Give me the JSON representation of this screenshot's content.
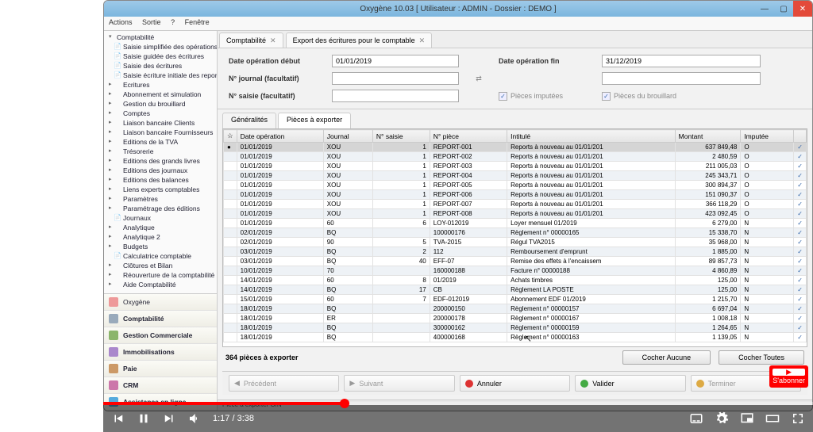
{
  "window": {
    "title": "Oxygène 10.03 [ Utilisateur : ADMIN - Dossier : DEMO ]",
    "menus": {
      "m1": "Actions",
      "m2": "Sortie",
      "m3": "?",
      "m4": "Fenêtre"
    }
  },
  "tree": {
    "root": "Comptabilité",
    "items": [
      "Saisie simplifiée des opérations",
      "Saisie guidée des écritures",
      "Saisie des écritures",
      "Saisie écriture initiale des reports",
      "Ecritures",
      "Abonnement et simulation",
      "Gestion du brouillard",
      "Comptes",
      "Liaison bancaire Clients",
      "Liaison bancaire Fournisseurs",
      "Editions de la TVA",
      "Trésorerie",
      "Editions des grands livres",
      "Editions des journaux",
      "Editions des balances",
      "Liens experts comptables",
      "Paramètres",
      "Paramétrage des éditions",
      "Journaux",
      "Analytique",
      "Analytique 2",
      "Budgets",
      "Calculatrice comptable",
      "Clôtures et Bilan",
      "Réouverture de la comptabilité",
      "Aide Comptabilité"
    ]
  },
  "modules": {
    "m0": "Oxygène",
    "m1": "Comptabilité",
    "m2": "Gestion Commerciale",
    "m3": "Immobilisations",
    "m4": "Paie",
    "m5": "CRM",
    "m6": "Assistance en ligne"
  },
  "tabs": {
    "t0": "Comptabilité",
    "t1": "Export des écritures pour le comptable"
  },
  "form": {
    "dateStartLabel": "Date opération début",
    "dateStart": "01/01/2019",
    "dateEndLabel": "Date opération fin",
    "dateEnd": "31/12/2019",
    "journalLabel": "N° journal (facultatif)",
    "saisieLabel": "N° saisie (facultatif)",
    "chk1": "Pièces imputées",
    "chk2": "Pièces du brouillard"
  },
  "subtabs": {
    "s0": "Généralités",
    "s1": "Pièces à exporter"
  },
  "grid": {
    "headers": {
      "h0": "Date opération",
      "h1": "Journal",
      "h2": "N° saisie",
      "h3": "N° pièce",
      "h4": "Intitulé",
      "h5": "Montant",
      "h6": "Imputée"
    },
    "rows": [
      {
        "d": "01/01/2019",
        "j": "XOU",
        "s": "1",
        "p": "REPORT-001",
        "i": "Reports à nouveau au 01/01/201",
        "m": "637 849,48",
        "f": "O"
      },
      {
        "d": "01/01/2019",
        "j": "XOU",
        "s": "1",
        "p": "REPORT-002",
        "i": "Reports à nouveau au 01/01/201",
        "m": "2 480,59",
        "f": "O"
      },
      {
        "d": "01/01/2019",
        "j": "XOU",
        "s": "1",
        "p": "REPORT-003",
        "i": "Reports à nouveau au 01/01/201",
        "m": "211 005,03",
        "f": "O"
      },
      {
        "d": "01/01/2019",
        "j": "XOU",
        "s": "1",
        "p": "REPORT-004",
        "i": "Reports à nouveau au 01/01/201",
        "m": "245 343,71",
        "f": "O"
      },
      {
        "d": "01/01/2019",
        "j": "XOU",
        "s": "1",
        "p": "REPORT-005",
        "i": "Reports à nouveau au 01/01/201",
        "m": "300 894,37",
        "f": "O"
      },
      {
        "d": "01/01/2019",
        "j": "XOU",
        "s": "1",
        "p": "REPORT-006",
        "i": "Reports à nouveau au 01/01/201",
        "m": "151 090,37",
        "f": "O"
      },
      {
        "d": "01/01/2019",
        "j": "XOU",
        "s": "1",
        "p": "REPORT-007",
        "i": "Reports à nouveau au 01/01/201",
        "m": "366 118,29",
        "f": "O"
      },
      {
        "d": "01/01/2019",
        "j": "XOU",
        "s": "1",
        "p": "REPORT-008",
        "i": "Reports à nouveau au 01/01/201",
        "m": "423 092,45",
        "f": "O"
      },
      {
        "d": "01/01/2019",
        "j": "60",
        "s": "6",
        "p": "LOY-012019",
        "i": "Loyer mensuel 01/2019",
        "m": "6 279,00",
        "f": "N"
      },
      {
        "d": "02/01/2019",
        "j": "BQ",
        "s": "",
        "p": "100000176",
        "i": "Règlement n° 00000165",
        "m": "15 338,70",
        "f": "N"
      },
      {
        "d": "02/01/2019",
        "j": "90",
        "s": "5",
        "p": "TVA-2015",
        "i": "Régul TVA2015",
        "m": "35 968,00",
        "f": "N"
      },
      {
        "d": "03/01/2019",
        "j": "BQ",
        "s": "2",
        "p": "112",
        "i": "Remboursement d'emprunt",
        "m": "1 885,00",
        "f": "N"
      },
      {
        "d": "03/01/2019",
        "j": "BQ",
        "s": "40",
        "p": "EFF-07",
        "i": "Remise des effets à l'encaissem",
        "m": "89 857,73",
        "f": "N"
      },
      {
        "d": "10/01/2019",
        "j": "70",
        "s": "",
        "p": "160000188",
        "i": "Facture n° 00000188",
        "m": "4 860,89",
        "f": "N"
      },
      {
        "d": "14/01/2019",
        "j": "60",
        "s": "8",
        "p": "01/2019",
        "i": "Achats timbres",
        "m": "125,00",
        "f": "N"
      },
      {
        "d": "14/01/2019",
        "j": "BQ",
        "s": "17",
        "p": "CB",
        "i": "Règlement LA POSTE",
        "m": "125,00",
        "f": "N"
      },
      {
        "d": "15/01/2019",
        "j": "60",
        "s": "7",
        "p": "EDF-012019",
        "i": "Abonnement EDF 01/2019",
        "m": "1 215,70",
        "f": "N"
      },
      {
        "d": "18/01/2019",
        "j": "BQ",
        "s": "",
        "p": "200000150",
        "i": "Règlement n° 00000157",
        "m": "6 697,04",
        "f": "N"
      },
      {
        "d": "18/01/2019",
        "j": "ER",
        "s": "",
        "p": "200000178",
        "i": "Règlement n° 00000167",
        "m": "1 008,18",
        "f": "N"
      },
      {
        "d": "18/01/2019",
        "j": "BQ",
        "s": "",
        "p": "300000162",
        "i": "Règlement n° 00000159",
        "m": "1 264,65",
        "f": "N"
      },
      {
        "d": "18/01/2019",
        "j": "BQ",
        "s": "",
        "p": "400000168",
        "i": "Règlement n° 00000163",
        "m": "1 139,05",
        "f": "N"
      }
    ]
  },
  "counter": {
    "text": "364 pièces à exporter",
    "btnNone": "Cocher Aucune",
    "btnAll": "Cocher Toutes"
  },
  "wizard": {
    "prev": "Précédent",
    "next": "Suivant",
    "cancel": "Annuler",
    "validate": "Valider",
    "finish": "Terminer"
  },
  "status": {
    "text": "Pièce à exporter O/N"
  },
  "youtube": {
    "time": "1:17 / 3:38",
    "sub": "S'abonner"
  }
}
